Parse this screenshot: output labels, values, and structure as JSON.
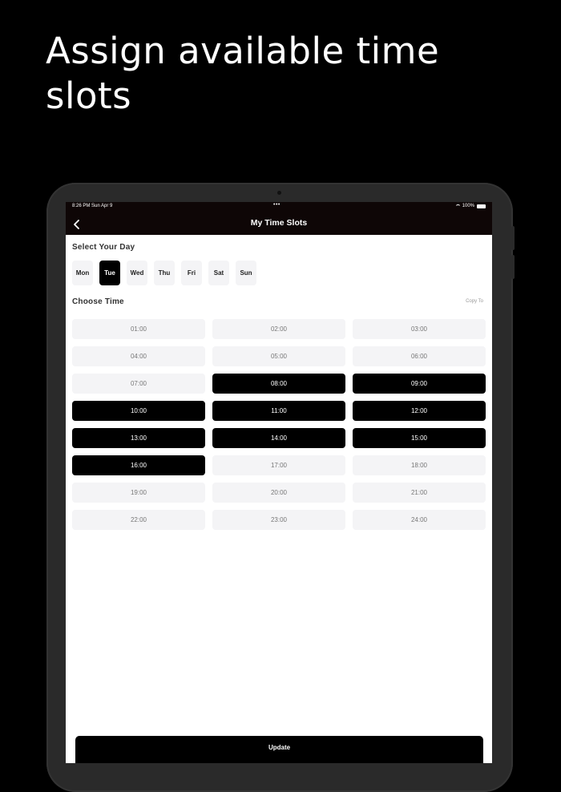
{
  "headline": "Assign available time slots",
  "status_bar": {
    "time": "8:26 PM  Sun Apr 9",
    "dots": "•••",
    "battery": "100%"
  },
  "nav": {
    "title": "My Time Slots",
    "back_icon": "chevron-left-icon"
  },
  "select_day": {
    "label": "Select Your Day",
    "days": [
      {
        "label": "Mon",
        "selected": false
      },
      {
        "label": "Tue",
        "selected": true
      },
      {
        "label": "Wed",
        "selected": false
      },
      {
        "label": "Thu",
        "selected": false
      },
      {
        "label": "Fri",
        "selected": false
      },
      {
        "label": "Sat",
        "selected": false
      },
      {
        "label": "Sun",
        "selected": false
      }
    ]
  },
  "choose_time": {
    "label": "Choose Time",
    "copy_to": "Copy To",
    "slots": [
      {
        "label": "01:00",
        "selected": false
      },
      {
        "label": "02:00",
        "selected": false
      },
      {
        "label": "03:00",
        "selected": false
      },
      {
        "label": "04:00",
        "selected": false
      },
      {
        "label": "05:00",
        "selected": false
      },
      {
        "label": "06:00",
        "selected": false
      },
      {
        "label": "07:00",
        "selected": false
      },
      {
        "label": "08:00",
        "selected": true
      },
      {
        "label": "09:00",
        "selected": true
      },
      {
        "label": "10:00",
        "selected": true
      },
      {
        "label": "11:00",
        "selected": true
      },
      {
        "label": "12:00",
        "selected": true
      },
      {
        "label": "13:00",
        "selected": true
      },
      {
        "label": "14:00",
        "selected": true
      },
      {
        "label": "15:00",
        "selected": true
      },
      {
        "label": "16:00",
        "selected": true
      },
      {
        "label": "17:00",
        "selected": false
      },
      {
        "label": "18:00",
        "selected": false
      },
      {
        "label": "19:00",
        "selected": false
      },
      {
        "label": "20:00",
        "selected": false
      },
      {
        "label": "21:00",
        "selected": false
      },
      {
        "label": "22:00",
        "selected": false
      },
      {
        "label": "23:00",
        "selected": false
      },
      {
        "label": "24:00",
        "selected": false
      }
    ]
  },
  "update_button": "Update",
  "colors": {
    "background": "#000000",
    "header": "#0e0606",
    "selected": "#000000",
    "unselected": "#f4f4f6"
  }
}
